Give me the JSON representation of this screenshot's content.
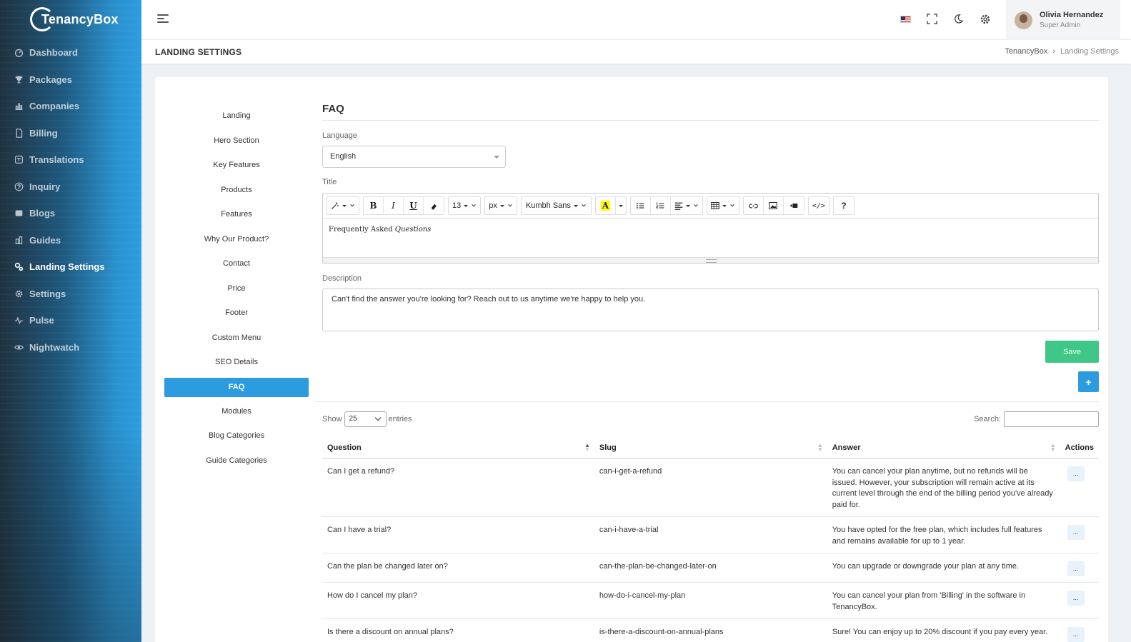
{
  "app": {
    "name": "TenancyBox"
  },
  "sidebar": {
    "items": [
      {
        "label": "Dashboard",
        "icon": "dashboard-icon"
      },
      {
        "label": "Packages",
        "icon": "trophy-icon"
      },
      {
        "label": "Companies",
        "icon": "chart-icon"
      },
      {
        "label": "Billing",
        "icon": "document-icon"
      },
      {
        "label": "Translations",
        "icon": "translate-icon"
      },
      {
        "label": "Inquiry",
        "icon": "question-icon"
      },
      {
        "label": "Blogs",
        "icon": "blog-icon"
      },
      {
        "label": "Guides",
        "icon": "guide-icon"
      },
      {
        "label": "Landing Settings",
        "icon": "cogs-icon",
        "active": true
      },
      {
        "label": "Settings",
        "icon": "gear-icon"
      },
      {
        "label": "Pulse",
        "icon": "pulse-icon"
      },
      {
        "label": "Nightwatch",
        "icon": "eye-icon"
      }
    ]
  },
  "topbar": {
    "user": {
      "name": "Olivia Hernandez",
      "role": "Super Admin"
    }
  },
  "page": {
    "title": "LANDING SETTINGS",
    "breadcrumb": [
      "TenancyBox",
      "Landing Settings"
    ]
  },
  "settings_menu": {
    "items": [
      "Landing",
      "Hero Section",
      "Key Features",
      "Products",
      "Features",
      "Why Our Product?",
      "Contact",
      "Price",
      "Footer",
      "Custom Menu",
      "SEO Details",
      "FAQ",
      "Modules",
      "Blog Categories",
      "Guide Categories"
    ],
    "active": "FAQ"
  },
  "form": {
    "heading": "FAQ",
    "language_label": "Language",
    "language_value": "English",
    "title_label": "Title",
    "title_text_plain": "Frequently Asked ",
    "title_text_italic": "Questions",
    "toolbar": {
      "font_size": "13",
      "unit": "px",
      "font_family": "Kumbh Sans"
    },
    "description_label": "Description",
    "description_value": "Can't find the answer you're looking for? Reach out to us anytime we're happy to help you.",
    "save_label": "Save",
    "add_label": "+"
  },
  "table": {
    "show_label": "Show",
    "page_length": "25",
    "entries_label": "entries",
    "search_label": "Search:",
    "columns": [
      "Question",
      "Slug",
      "Answer",
      "Actions"
    ],
    "action_label": "...",
    "rows": [
      {
        "question": "Can I get a refund?",
        "slug": "can-i-get-a-refund",
        "answer": "You can cancel your plan anytime, but no refunds will be issued. However, your subscription will remain active at its current level through the end of the billing period you've already paid for."
      },
      {
        "question": "Can I have a trial?",
        "slug": "can-i-have-a-trial",
        "answer": "You have opted for the free plan, which includes full features and remains available for up to 1 year."
      },
      {
        "question": "Can the plan be changed later on?",
        "slug": "can-the-plan-be-changed-later-on",
        "answer": "You can upgrade or downgrade your plan at any time."
      },
      {
        "question": "How do I cancel my plan?",
        "slug": "how-do-i-cancel-my-plan",
        "answer": "You can cancel your plan from 'Billing' in the software in TenancyBox."
      },
      {
        "question": "Is there a discount on annual plans?",
        "slug": "is-there-a-discount-on-annual-plans",
        "answer": "Sure! You can enjoy up to 20% discount if you pay every year."
      }
    ]
  }
}
